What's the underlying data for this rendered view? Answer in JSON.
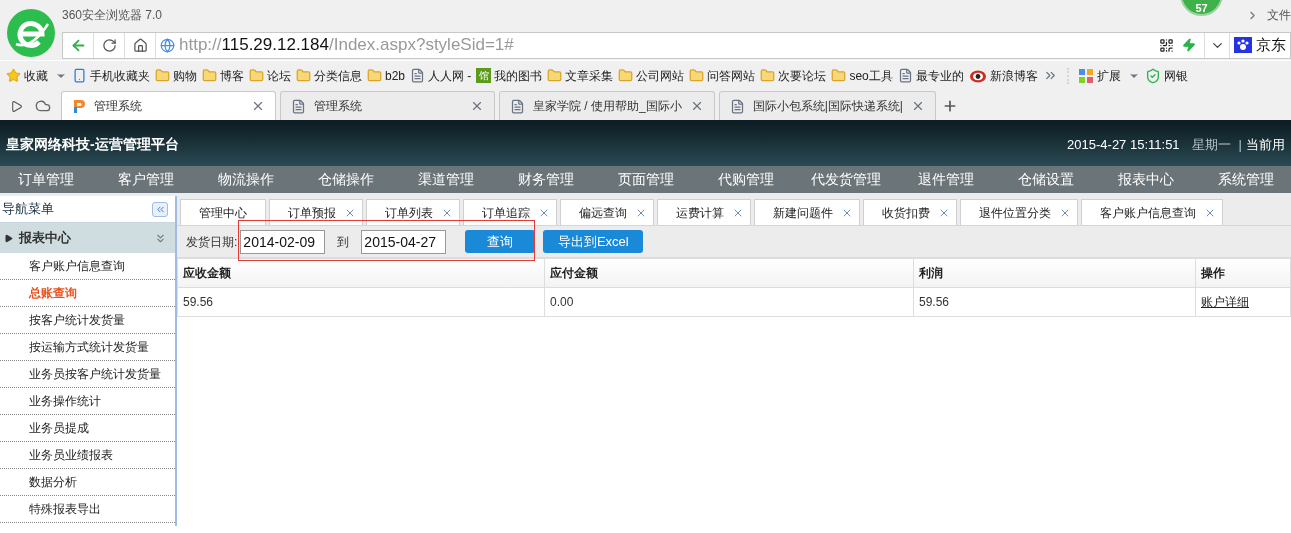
{
  "browser": {
    "title": "360安全浏览器 7.0",
    "badge": "57",
    "menu_partial": "文件",
    "address": {
      "scheme": "http://",
      "host": "115.29.12.184",
      "path": "/Index.aspx?styleSid=1#"
    },
    "search_engine": "京东",
    "bookmarks": [
      {
        "kind": "star",
        "label": "收藏",
        "dropdown": true
      },
      {
        "kind": "phone",
        "label": "手机收藏夹"
      },
      {
        "kind": "folder",
        "label": "购物"
      },
      {
        "kind": "folder",
        "label": "博客"
      },
      {
        "kind": "folder",
        "label": "论坛"
      },
      {
        "kind": "folder",
        "label": "分类信息"
      },
      {
        "kind": "folder",
        "label": "b2b"
      },
      {
        "kind": "page",
        "label": "人人网 -"
      },
      {
        "kind": "app",
        "label": "我的图书",
        "glyph": "馆"
      },
      {
        "kind": "folder",
        "label": "文章采集"
      },
      {
        "kind": "folder",
        "label": "公司网站"
      },
      {
        "kind": "folder",
        "label": "问答网站"
      },
      {
        "kind": "folder",
        "label": "次要论坛"
      },
      {
        "kind": "folder",
        "label": "seo工具"
      },
      {
        "kind": "page",
        "label": "最专业的"
      },
      {
        "kind": "weibo",
        "label": "新浪博客"
      }
    ],
    "extras": [
      {
        "kind": "extensions",
        "label": "扩展",
        "dropdown": true
      },
      {
        "kind": "shield",
        "label": "网银"
      }
    ],
    "tabs": [
      {
        "label": "管理系统",
        "selected": true,
        "kind": "app"
      },
      {
        "label": "管理系统",
        "selected": false,
        "kind": "page"
      },
      {
        "label": "皇家学院 / 使用帮助_国际小",
        "selected": false,
        "kind": "page"
      },
      {
        "label": "国际小包系统|国际快递系统|",
        "selected": false,
        "kind": "page"
      }
    ]
  },
  "app": {
    "title": "皇家网络科技-运营管理平台",
    "datetime": "2015-4-27 15:11:51",
    "weekday": "星期一",
    "separator": "|",
    "user_partial": "当前用",
    "nav": [
      "订单管理",
      "客户管理",
      "物流操作",
      "仓储操作",
      "渠道管理",
      "财务管理",
      "页面管理",
      "代购管理",
      "代发货管理",
      "退件管理",
      "仓储设置",
      "报表中心",
      "系统管理"
    ],
    "sidebar": {
      "title": "导航菜单",
      "section": {
        "title": "报表中心",
        "expanded": true
      },
      "items": [
        {
          "label": "客户账户信息查询",
          "selected": false
        },
        {
          "label": "总账查询",
          "selected": true
        },
        {
          "label": "按客户统计发货量",
          "selected": false
        },
        {
          "label": "按运输方式统计发货量",
          "selected": false
        },
        {
          "label": "业务员按客户统计发货量",
          "selected": false
        },
        {
          "label": "业务操作统计",
          "selected": false
        },
        {
          "label": "业务员提成",
          "selected": false
        },
        {
          "label": "业务员业绩报表",
          "selected": false
        },
        {
          "label": "数据分析",
          "selected": false
        },
        {
          "label": "特殊报表导出",
          "selected": false
        }
      ]
    },
    "page_tabs": [
      {
        "label": "管理中心",
        "closable": false
      },
      {
        "label": "订单预报",
        "closable": true
      },
      {
        "label": "订单列表",
        "closable": true
      },
      {
        "label": "订单追踪",
        "closable": true
      },
      {
        "label": "偏远查询",
        "closable": true
      },
      {
        "label": "运费计算",
        "closable": true
      },
      {
        "label": "新建问题件",
        "closable": true
      },
      {
        "label": "收货扣费",
        "closable": true
      },
      {
        "label": "退件位置分类",
        "closable": true
      },
      {
        "label": "客户账户信息查询",
        "closable": true
      }
    ],
    "filter": {
      "label": "发货日期:",
      "from": "2014-02-09",
      "to_label": "到",
      "to": "2015-04-27",
      "highlighted": true,
      "buttons": [
        "查询",
        "导出到Excel"
      ]
    },
    "table": {
      "columns": [
        "应收金额",
        "应付金额",
        "利润",
        "操作"
      ],
      "rows": [
        {
          "cells": [
            "59.56",
            "0.00",
            "59.56"
          ],
          "action": "账户详细"
        }
      ]
    }
  }
}
